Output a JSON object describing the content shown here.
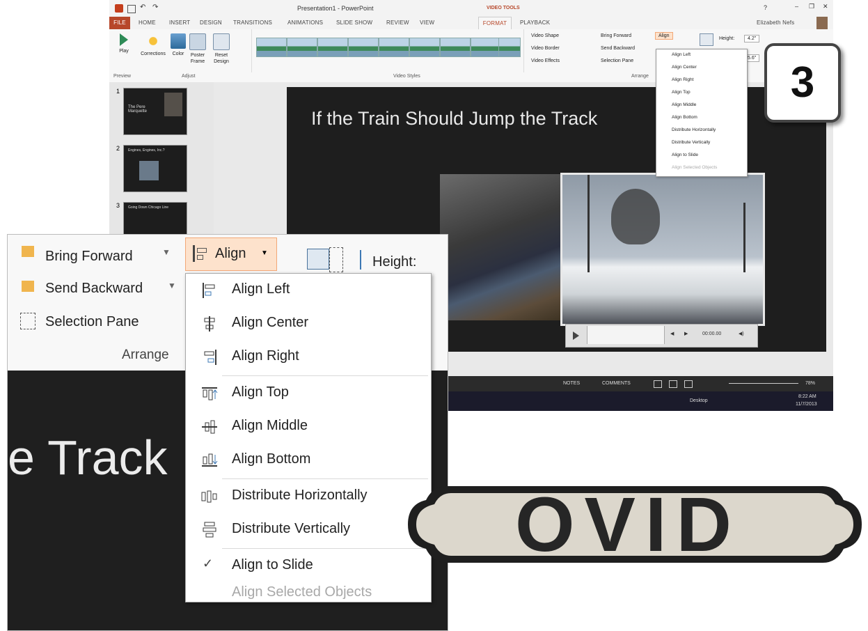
{
  "app": {
    "title": "Presentation1 - PowerPoint",
    "context_tab_group": "VIDEO TOOLS",
    "user": "Elizabeth Nefs",
    "tabs": [
      "FILE",
      "HOME",
      "INSERT",
      "DESIGN",
      "TRANSITIONS",
      "ANIMATIONS",
      "SLIDE SHOW",
      "REVIEW",
      "VIEW",
      "FORMAT",
      "PLAYBACK"
    ],
    "active_tab": "FORMAT"
  },
  "ribbon": {
    "play": "Play",
    "corrections": "Corrections",
    "color": "Color",
    "poster_frame": "Poster Frame",
    "reset_design": "Reset Design",
    "group_preview": "Preview",
    "group_adjust": "Adjust",
    "group_video_styles": "Video Styles",
    "video_shape": "Video Shape",
    "video_border": "Video Border",
    "video_effects": "Video Effects",
    "bring_forward": "Bring Forward",
    "send_backward": "Send Backward",
    "selection_pane": "Selection Pane",
    "align": "Align",
    "group_arrange": "Arrange",
    "height_label": "Height:",
    "height_value": "4.2\"",
    "width_value": "5.6\""
  },
  "thumbnails": [
    {
      "num": "1",
      "text": "The Pere Marquette"
    },
    {
      "num": "2",
      "text": "Engines, Engines, Inc.?"
    },
    {
      "num": "3",
      "text": "Going Down Chicago Line"
    }
  ],
  "slide": {
    "title": "If the Train Should Jump the Track"
  },
  "player": {
    "time": "00:00.00"
  },
  "status": {
    "notes": "NOTES",
    "comments": "COMMENTS",
    "zoom": "78%"
  },
  "taskbar": {
    "desktop": "Desktop",
    "time": "8:22 AM",
    "date": "11/7/2013"
  },
  "step": "3",
  "zoom": {
    "bring_forward": "Bring Forward",
    "send_backward": "Send Backward",
    "selection_pane": "Selection Pane",
    "arrange": "Arrange",
    "align": "Align",
    "height": "Height:",
    "track_text": "e Track"
  },
  "align_menu": [
    {
      "label": "Align Left",
      "icon": "align-left-icon",
      "enabled": true
    },
    {
      "label": "Align Center",
      "icon": "align-center-icon",
      "enabled": true
    },
    {
      "label": "Align Right",
      "icon": "align-right-icon",
      "enabled": true
    },
    {
      "label": "Align Top",
      "icon": "align-top-icon",
      "enabled": true
    },
    {
      "label": "Align Middle",
      "icon": "align-middle-icon",
      "enabled": true
    },
    {
      "label": "Align Bottom",
      "icon": "align-bottom-icon",
      "enabled": true
    },
    {
      "label": "Distribute Horizontally",
      "icon": "distribute-horizontally-icon",
      "enabled": true
    },
    {
      "label": "Distribute Vertically",
      "icon": "distribute-vertically-icon",
      "enabled": true
    },
    {
      "label": "Align to Slide",
      "icon": "checkmark-icon",
      "enabled": true,
      "checked": true
    },
    {
      "label": "Align Selected Objects",
      "icon": "",
      "enabled": false
    }
  ],
  "sign": {
    "text": "OVID"
  },
  "colors": {
    "accent": "#b7472a",
    "align_highlight": "#fde2cc",
    "slide_bg": "#1e1e1e"
  }
}
